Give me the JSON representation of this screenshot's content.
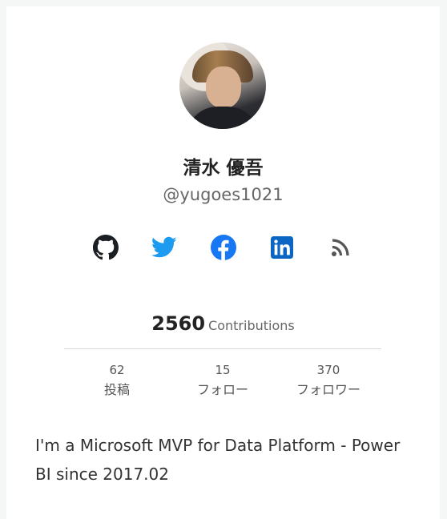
{
  "profile": {
    "name": "清水 優吾",
    "handle": "@yugoes1021",
    "bio": "I'm a Microsoft MVP for Data Platform - Power BI since 2017.02"
  },
  "social": {
    "icons": [
      "github-icon",
      "twitter-icon",
      "facebook-icon",
      "linkedin-icon",
      "rss-icon"
    ],
    "colors": {
      "github": "#1b1f23",
      "twitter": "#1d9bf0",
      "facebook": "#1877f2",
      "linkedin": "#0a66c2",
      "rss": "#555555"
    }
  },
  "contributions": {
    "count": "2560",
    "label": "Contributions"
  },
  "stats": [
    {
      "value": "62",
      "label": "投稿"
    },
    {
      "value": "15",
      "label": "フォロー"
    },
    {
      "value": "370",
      "label": "フォロワー"
    }
  ]
}
